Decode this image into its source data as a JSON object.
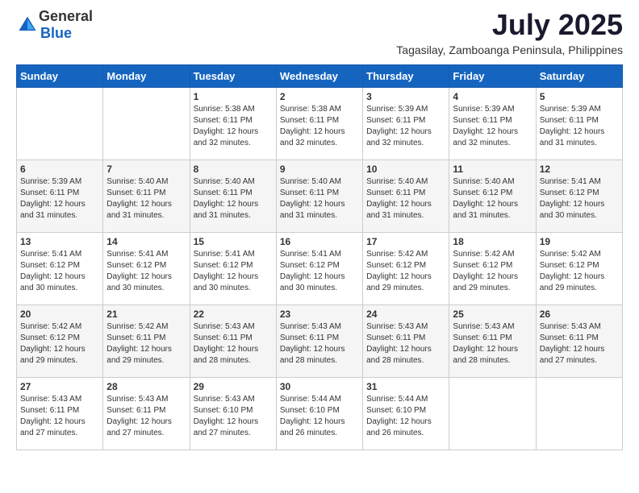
{
  "header": {
    "logo_general": "General",
    "logo_blue": "Blue",
    "main_title": "July 2025",
    "subtitle": "Tagasilay, Zamboanga Peninsula, Philippines"
  },
  "calendar": {
    "days_of_week": [
      "Sunday",
      "Monday",
      "Tuesday",
      "Wednesday",
      "Thursday",
      "Friday",
      "Saturday"
    ],
    "weeks": [
      [
        {
          "day": "",
          "info": ""
        },
        {
          "day": "",
          "info": ""
        },
        {
          "day": "1",
          "info": "Sunrise: 5:38 AM\nSunset: 6:11 PM\nDaylight: 12 hours and 32 minutes."
        },
        {
          "day": "2",
          "info": "Sunrise: 5:38 AM\nSunset: 6:11 PM\nDaylight: 12 hours and 32 minutes."
        },
        {
          "day": "3",
          "info": "Sunrise: 5:39 AM\nSunset: 6:11 PM\nDaylight: 12 hours and 32 minutes."
        },
        {
          "day": "4",
          "info": "Sunrise: 5:39 AM\nSunset: 6:11 PM\nDaylight: 12 hours and 32 minutes."
        },
        {
          "day": "5",
          "info": "Sunrise: 5:39 AM\nSunset: 6:11 PM\nDaylight: 12 hours and 31 minutes."
        }
      ],
      [
        {
          "day": "6",
          "info": "Sunrise: 5:39 AM\nSunset: 6:11 PM\nDaylight: 12 hours and 31 minutes."
        },
        {
          "day": "7",
          "info": "Sunrise: 5:40 AM\nSunset: 6:11 PM\nDaylight: 12 hours and 31 minutes."
        },
        {
          "day": "8",
          "info": "Sunrise: 5:40 AM\nSunset: 6:11 PM\nDaylight: 12 hours and 31 minutes."
        },
        {
          "day": "9",
          "info": "Sunrise: 5:40 AM\nSunset: 6:11 PM\nDaylight: 12 hours and 31 minutes."
        },
        {
          "day": "10",
          "info": "Sunrise: 5:40 AM\nSunset: 6:11 PM\nDaylight: 12 hours and 31 minutes."
        },
        {
          "day": "11",
          "info": "Sunrise: 5:40 AM\nSunset: 6:12 PM\nDaylight: 12 hours and 31 minutes."
        },
        {
          "day": "12",
          "info": "Sunrise: 5:41 AM\nSunset: 6:12 PM\nDaylight: 12 hours and 30 minutes."
        }
      ],
      [
        {
          "day": "13",
          "info": "Sunrise: 5:41 AM\nSunset: 6:12 PM\nDaylight: 12 hours and 30 minutes."
        },
        {
          "day": "14",
          "info": "Sunrise: 5:41 AM\nSunset: 6:12 PM\nDaylight: 12 hours and 30 minutes."
        },
        {
          "day": "15",
          "info": "Sunrise: 5:41 AM\nSunset: 6:12 PM\nDaylight: 12 hours and 30 minutes."
        },
        {
          "day": "16",
          "info": "Sunrise: 5:41 AM\nSunset: 6:12 PM\nDaylight: 12 hours and 30 minutes."
        },
        {
          "day": "17",
          "info": "Sunrise: 5:42 AM\nSunset: 6:12 PM\nDaylight: 12 hours and 29 minutes."
        },
        {
          "day": "18",
          "info": "Sunrise: 5:42 AM\nSunset: 6:12 PM\nDaylight: 12 hours and 29 minutes."
        },
        {
          "day": "19",
          "info": "Sunrise: 5:42 AM\nSunset: 6:12 PM\nDaylight: 12 hours and 29 minutes."
        }
      ],
      [
        {
          "day": "20",
          "info": "Sunrise: 5:42 AM\nSunset: 6:12 PM\nDaylight: 12 hours and 29 minutes."
        },
        {
          "day": "21",
          "info": "Sunrise: 5:42 AM\nSunset: 6:11 PM\nDaylight: 12 hours and 29 minutes."
        },
        {
          "day": "22",
          "info": "Sunrise: 5:43 AM\nSunset: 6:11 PM\nDaylight: 12 hours and 28 minutes."
        },
        {
          "day": "23",
          "info": "Sunrise: 5:43 AM\nSunset: 6:11 PM\nDaylight: 12 hours and 28 minutes."
        },
        {
          "day": "24",
          "info": "Sunrise: 5:43 AM\nSunset: 6:11 PM\nDaylight: 12 hours and 28 minutes."
        },
        {
          "day": "25",
          "info": "Sunrise: 5:43 AM\nSunset: 6:11 PM\nDaylight: 12 hours and 28 minutes."
        },
        {
          "day": "26",
          "info": "Sunrise: 5:43 AM\nSunset: 6:11 PM\nDaylight: 12 hours and 27 minutes."
        }
      ],
      [
        {
          "day": "27",
          "info": "Sunrise: 5:43 AM\nSunset: 6:11 PM\nDaylight: 12 hours and 27 minutes."
        },
        {
          "day": "28",
          "info": "Sunrise: 5:43 AM\nSunset: 6:11 PM\nDaylight: 12 hours and 27 minutes."
        },
        {
          "day": "29",
          "info": "Sunrise: 5:43 AM\nSunset: 6:10 PM\nDaylight: 12 hours and 27 minutes."
        },
        {
          "day": "30",
          "info": "Sunrise: 5:44 AM\nSunset: 6:10 PM\nDaylight: 12 hours and 26 minutes."
        },
        {
          "day": "31",
          "info": "Sunrise: 5:44 AM\nSunset: 6:10 PM\nDaylight: 12 hours and 26 minutes."
        },
        {
          "day": "",
          "info": ""
        },
        {
          "day": "",
          "info": ""
        }
      ]
    ]
  }
}
